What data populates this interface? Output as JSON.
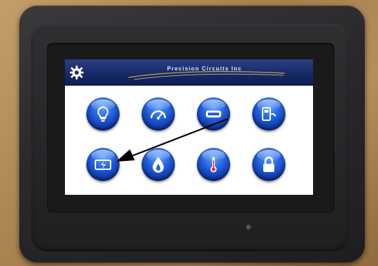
{
  "header": {
    "title": "Precision Circuits Inc",
    "settings_icon": "gear-icon",
    "bar_color": "#182a66"
  },
  "buttons": [
    {
      "name": "lighting-button",
      "icon": "lightbulb-icon"
    },
    {
      "name": "gauge-button",
      "icon": "speedometer-icon"
    },
    {
      "name": "equipment-button",
      "icon": "cylinder-icon"
    },
    {
      "name": "fuel-button",
      "icon": "fuel-pump-icon"
    },
    {
      "name": "power-button",
      "icon": "battery-charge-icon"
    },
    {
      "name": "flame-button",
      "icon": "water-flame-icon"
    },
    {
      "name": "temperature-button",
      "icon": "thermometer-icon"
    },
    {
      "name": "lock-button",
      "icon": "padlock-icon"
    }
  ],
  "colors": {
    "button_blue": "#1e58d6",
    "bezel": "#2a2a2c",
    "screen_bg": "#ffffff",
    "arrow": "#000000"
  },
  "annotation": {
    "type": "arrow",
    "description_icon": "arrow-icon"
  }
}
